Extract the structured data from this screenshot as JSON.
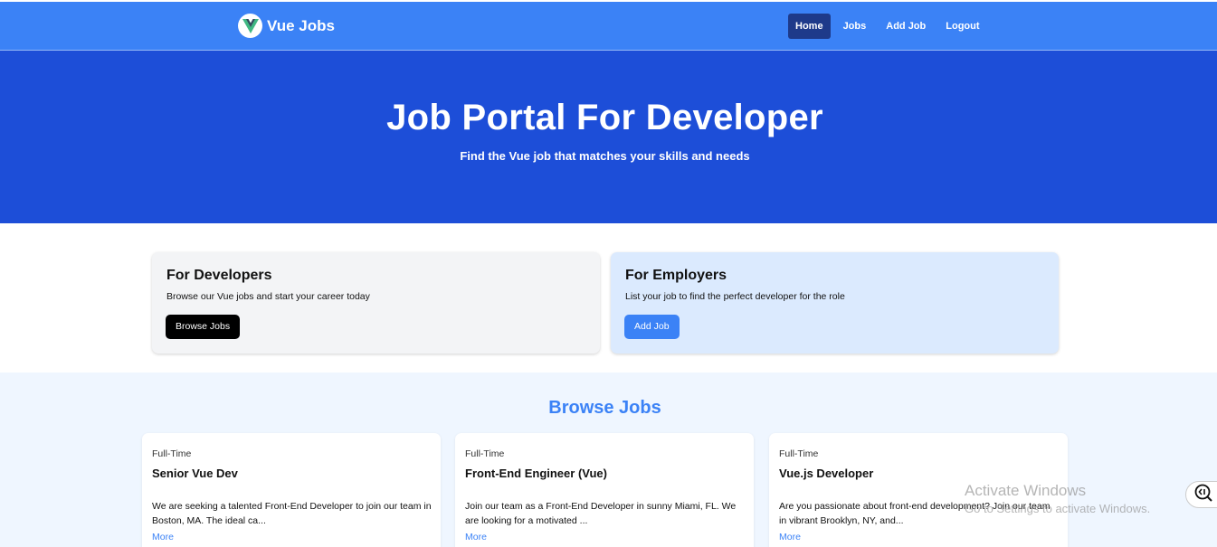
{
  "nav": {
    "brand": "Vue Jobs",
    "links": [
      {
        "label": "Home",
        "active": true
      },
      {
        "label": "Jobs",
        "active": false
      },
      {
        "label": "Add Job",
        "active": false
      },
      {
        "label": "Logout",
        "active": false
      }
    ]
  },
  "hero": {
    "title": "Job Portal For Developer",
    "subtitle": "Find the Vue job that matches your skills and needs"
  },
  "cards": {
    "developers": {
      "title": "For Developers",
      "text": "Browse our Vue jobs and start your career today",
      "button": "Browse Jobs"
    },
    "employers": {
      "title": "For Employers",
      "text": "List your job to find the perfect developer for the role",
      "button": "Add Job"
    }
  },
  "browse": {
    "title": "Browse Jobs",
    "jobs": [
      {
        "type": "Full-Time",
        "title": "Senior Vue Dev",
        "description": "We are seeking a talented Front-End Developer to join our team in Boston, MA. The ideal ca...",
        "more": "More"
      },
      {
        "type": "Full-Time",
        "title": "Front-End Engineer (Vue)",
        "description": "Join our team as a Front-End Developer in sunny Miami, FL. We are looking for a motivated ...",
        "more": "More"
      },
      {
        "type": "Full-Time",
        "title": "Vue.js Developer",
        "description": "Are you passionate about front-end development? Join our team in vibrant Brooklyn, NY, and...",
        "more": "More"
      }
    ]
  },
  "watermark": {
    "line1": "Activate Windows",
    "line2": "Go to Settings to activate Windows."
  },
  "colors": {
    "nav": "#3b82f6",
    "hero": "#1d4ed8",
    "accent": "#3b82f6",
    "active_nav": "#1e3a8a"
  },
  "icons": {
    "logo": "vue-logo-icon",
    "side": "screen-reader-icon"
  }
}
